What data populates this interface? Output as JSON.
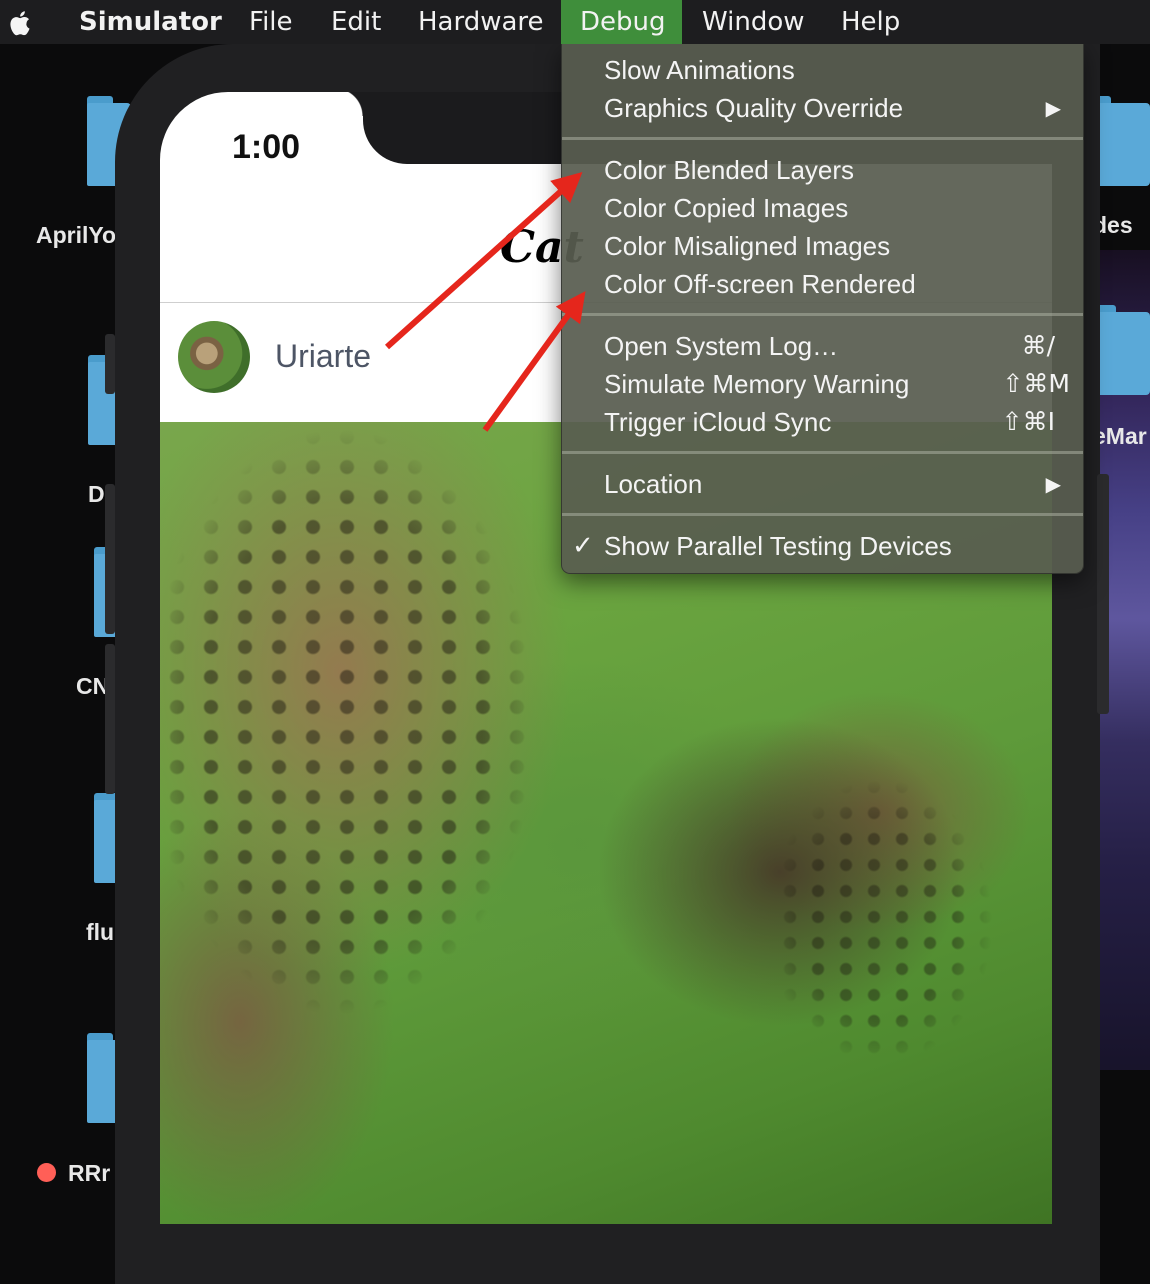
{
  "menubar": {
    "apple_icon": "apple-logo-icon",
    "app_name": "Simulator",
    "items": [
      "File",
      "Edit",
      "Hardware",
      "Debug",
      "Window",
      "Help"
    ],
    "active_item": "Debug",
    "active_color": "#3f8e3b"
  },
  "desktop": {
    "labels": [
      "AprilYo",
      "D",
      "CN",
      "flu",
      "RRr",
      "des",
      "eMar"
    ],
    "status_dot_color": "#ff5f57"
  },
  "phone": {
    "status_time": "1:00",
    "nav_title": "Cat",
    "user_name": "Uriarte",
    "avatar_icon": "cheetah-avatar",
    "photo": "cheetah-photo"
  },
  "debug_menu": {
    "groups": [
      {
        "items": [
          {
            "label": "Slow Animations",
            "shortcut": "",
            "submenu": false
          },
          {
            "label": "Graphics Quality Override",
            "shortcut": "",
            "submenu": true
          }
        ]
      },
      {
        "items": [
          {
            "label": "Color Blended Layers",
            "shortcut": "",
            "submenu": false
          },
          {
            "label": "Color Copied Images",
            "shortcut": "",
            "submenu": false
          },
          {
            "label": "Color Misaligned Images",
            "shortcut": "",
            "submenu": false
          },
          {
            "label": "Color Off-screen Rendered",
            "shortcut": "",
            "submenu": false
          }
        ]
      },
      {
        "items": [
          {
            "label": "Open System Log…",
            "shortcut": "⌘/",
            "submenu": false
          },
          {
            "label": "Simulate Memory Warning",
            "shortcut": "⇧⌘M",
            "submenu": false
          },
          {
            "label": "Trigger iCloud Sync",
            "shortcut": "⇧⌘I",
            "submenu": false
          }
        ]
      },
      {
        "items": [
          {
            "label": "Location",
            "shortcut": "",
            "submenu": true
          }
        ]
      },
      {
        "items": [
          {
            "label": "Show Parallel Testing Devices",
            "shortcut": "",
            "submenu": false,
            "checked": true
          }
        ]
      }
    ],
    "checkmark": "✓",
    "submenu_arrow": "▶"
  },
  "annotations": {
    "arrow_color": "#e5261c",
    "targets": [
      "Color Blended Layers",
      "Color Off-screen Rendered"
    ]
  }
}
